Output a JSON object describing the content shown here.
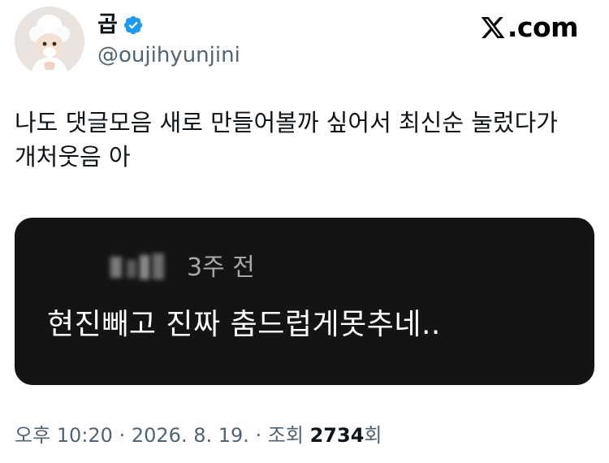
{
  "author": {
    "display_name": "곱",
    "handle": "@oujihyunjini",
    "verified": true,
    "verified_color": "#1d9bf0"
  },
  "brand": {
    "site": ".com"
  },
  "tweet": {
    "text": "나도 댓글모음 새로 만들어볼까 싶어서 최신순 눌렀다가\n개처웃음 아"
  },
  "media": {
    "background": "#141414",
    "comment": {
      "time": "3주 전",
      "text": "현진빼고 진짜 춤드럽게못추네.."
    }
  },
  "meta": {
    "time": "오후 10:20",
    "date": "2026. 8. 19.",
    "views_label": "조회",
    "views_count": "2734",
    "views_suffix": "회"
  }
}
